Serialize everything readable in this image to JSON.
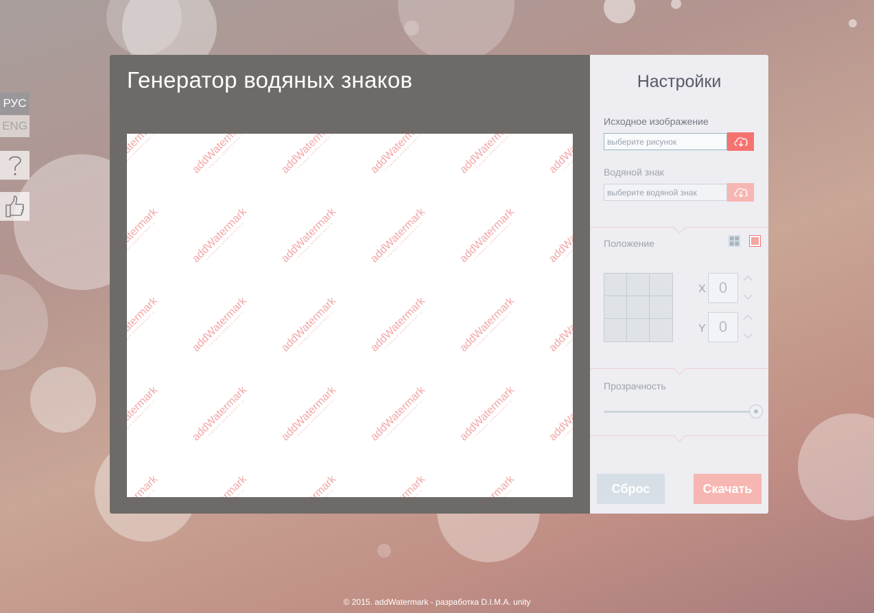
{
  "app": {
    "title": "Генератор водяных знаков"
  },
  "nav": {
    "languages": [
      {
        "label": "РУС",
        "active": true
      },
      {
        "label": "ENG",
        "active": false
      }
    ],
    "help_icon": "question-mark-icon",
    "like_icon": "thumbs-up-icon"
  },
  "preview": {
    "watermark_text": "addWatermark",
    "watermark_subtext": "с помощью addWatermark.ru"
  },
  "settings": {
    "title": "Настройки",
    "source": {
      "label": "Исходное изображение",
      "placeholder": "выберите рисунок"
    },
    "watermark": {
      "label": "Водяной знак",
      "placeholder": "выберите водяной знак"
    },
    "position": {
      "label": "Положение",
      "x_label": "X",
      "x_value": "0",
      "y_label": "Y",
      "y_value": "0"
    },
    "opacity": {
      "label": "Прозрачность",
      "value": 1.0
    },
    "reset_label": "Сброс",
    "download_label": "Скачать"
  },
  "colors": {
    "accent": "#f5736f",
    "accent_disabled": "#f6b6b3",
    "panel_dark": "#6d6a67",
    "panel_light": "#ededf2"
  },
  "footer": {
    "text": "© 2015. addWatermark - разработка D.I.M.A. unity"
  }
}
